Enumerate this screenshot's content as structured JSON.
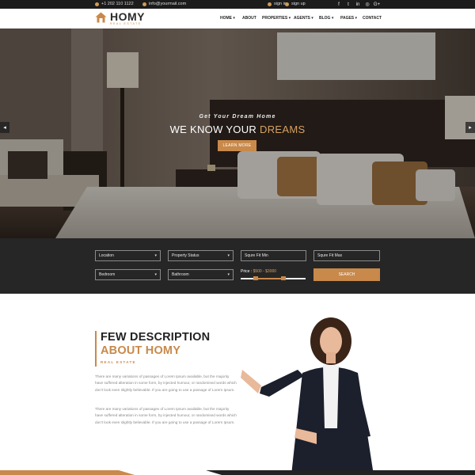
{
  "topbar": {
    "phone": "+1 202 110 1122",
    "email": "info@yourmail.com",
    "signin": "sign in",
    "signup": "sign up",
    "social_icons": [
      "facebook-icon",
      "twitter-icon",
      "linkedin-icon",
      "instagram-icon",
      "google-plus-icon"
    ],
    "social_glyphs": [
      "f",
      "t",
      "in",
      "◎",
      "G+"
    ]
  },
  "brand": {
    "name": "HOMY",
    "tagline": "REAL ESTATE",
    "accent": "#c8894a"
  },
  "nav": {
    "items": [
      "HOME ▾",
      "ABOUT",
      "PROPERTIES ▾",
      "AGENTS ▾",
      "BLOG ▾",
      "PAGES ▾",
      "CONTACT"
    ]
  },
  "hero": {
    "kicker": "Get Your Dream Home",
    "title_plain": "WE KNOW YOUR ",
    "title_accent": "DREAMS",
    "button": "LEARN MORE",
    "prev": "◂",
    "next": "▸"
  },
  "search": {
    "location": "Location",
    "property_status": "Property Status",
    "sqft_min": "Squre Fit Min",
    "sqft_max": "Squre Fit Max",
    "bedroom": "Bedroom",
    "bathroom": "Bathroom",
    "price_label": "Price :",
    "price_value": "$500 - $3000",
    "price_range": {
      "min": 500,
      "max": 3000
    },
    "button": "SEARCH"
  },
  "about": {
    "heading_1": "FEW DESCRIPTION",
    "heading_2": "ABOUT HOMY",
    "subheading": "REAL ESTATE",
    "para_1": "There are many variations of passages of Lorem Ipsum available, but the majority have suffered alteration in some form, by injected humour, or randomised words which don't look even slightly believable. If you are going to use a passage of Lorem Ipsum.",
    "para_2": "There are many variations of passages of Lorem Ipsum available, but the majority have suffered alteration in some form, by injected humour, or randomised words which don't look even slightly believable. If you are going to use a passage of Lorem Ipsum."
  }
}
